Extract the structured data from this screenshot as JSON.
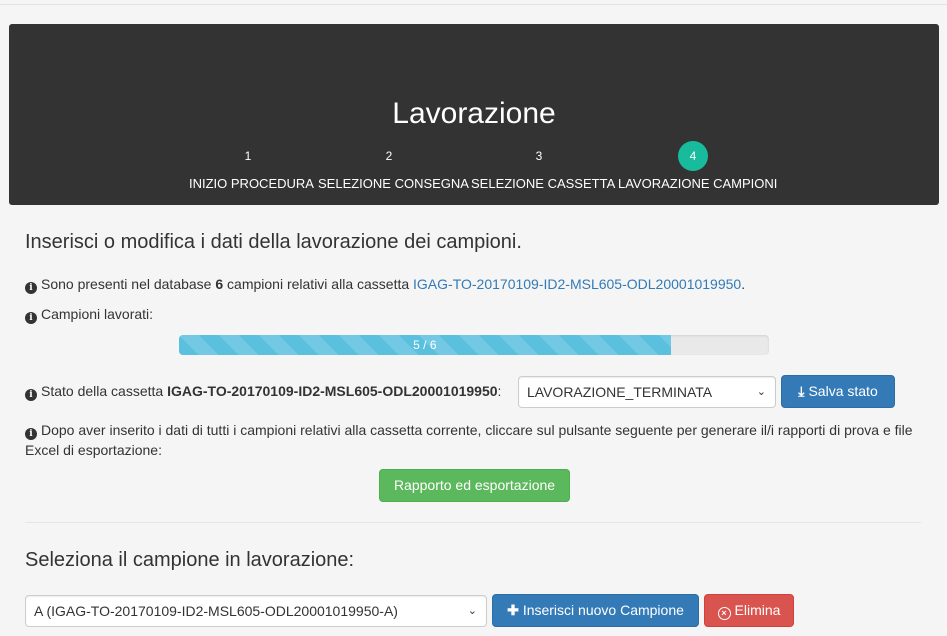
{
  "header": {
    "title": "Lavorazione",
    "steps": [
      {
        "num": "1",
        "label": "INIZIO PROCEDURA"
      },
      {
        "num": "2",
        "label": "SELEZIONE CONSEGNA"
      },
      {
        "num": "3",
        "label": "SELEZIONE CASSETTA"
      },
      {
        "num": "4",
        "label": "LAVORAZIONE CAMPIONI"
      }
    ],
    "active_step": 4,
    "active_color": "#18bc9c"
  },
  "main": {
    "heading": "Inserisci o modifica i dati della lavorazione dei campioni.",
    "db_info": {
      "prefix": "Sono presenti nel database",
      "count": "6",
      "middle": "campioni relativi alla cassetta",
      "cassetta_link": "IGAG-TO-20170109-ID2-MSL605-ODL20001019950",
      "suffix": "."
    },
    "progress": {
      "label": "Campioni lavorati:",
      "text": "5 / 6",
      "done": 5,
      "total": 6
    },
    "stato": {
      "prefix": "Stato della cassetta",
      "cassetta": "IGAG-TO-20170109-ID2-MSL605-ODL20001019950",
      "suffix": ":",
      "selected": "LAVORAZIONE_TERMINATA",
      "save_label": "Salva stato"
    },
    "export_info": "Dopo aver inserito i dati di tutti i campioni relativi alla cassetta corrente, cliccare sul pulsante seguente per generare il/i rapporti di prova e file Excel di esportazione:",
    "export_button": "Rapporto ed esportazione",
    "campione": {
      "heading": "Seleziona il campione in lavorazione:",
      "selected": "A (IGAG-TO-20170109-ID2-MSL605-ODL20001019950-A)",
      "add_label": "Inserisci nuovo Campione",
      "delete_label": "Elimina"
    }
  },
  "colors": {
    "primary": "#337ab7",
    "success": "#5cb85c",
    "danger": "#d9534f",
    "info": "#5bc0de",
    "header_bg": "#333333"
  },
  "icons": [
    "info-icon",
    "download-icon",
    "plus-icon",
    "circle-x-icon",
    "chevron-down-icon"
  ]
}
